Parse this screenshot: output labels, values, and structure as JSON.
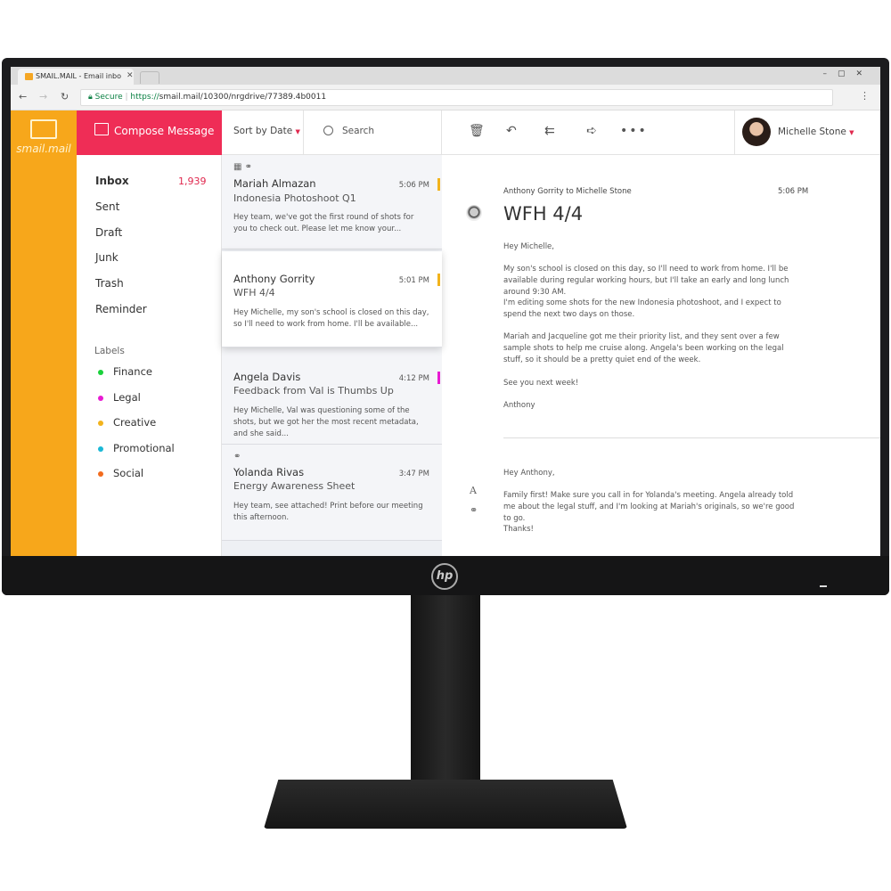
{
  "browser": {
    "tab_title": "SMAIL.MAIL - Email inbo",
    "secure_label": "Secure",
    "url_scheme": "https://",
    "url_rest": "smail.mail/10300/nrgdrive/77389.4b0011"
  },
  "brand": {
    "logo_text": "smail.mail",
    "accent": "#f7a71b",
    "compose_color": "#ef2d56",
    "monitor_logo": "hp"
  },
  "header": {
    "compose_label": "Compose Message",
    "sort_label": "Sort by Date",
    "search_placeholder": "Search",
    "user_name": "Michelle Stone"
  },
  "nav": {
    "items": [
      {
        "label": "Inbox",
        "count": "1,939"
      },
      {
        "label": "Sent"
      },
      {
        "label": "Draft"
      },
      {
        "label": "Junk"
      },
      {
        "label": "Trash"
      },
      {
        "label": "Reminder"
      }
    ],
    "labels_heading": "Labels",
    "labels": [
      {
        "label": "Finance",
        "color": "#19d13a"
      },
      {
        "label": "Legal",
        "color": "#e81ad2"
      },
      {
        "label": "Creative",
        "color": "#f2b31c"
      },
      {
        "label": "Promotional",
        "color": "#1ab8d6"
      },
      {
        "label": "Social",
        "color": "#f26b1d"
      }
    ]
  },
  "messages": [
    {
      "sender": "Mariah Almazan",
      "subject": "Indonesia Photoshoot Q1",
      "time": "5:06 PM",
      "preview": "Hey team, we've got the first round of shots for you to check out. Please let me know your...",
      "tag_color": "#f2b31c",
      "icons": [
        "calendar-icon",
        "link-icon"
      ]
    },
    {
      "sender": "Anthony Gorrity",
      "subject": "WFH 4/4",
      "time": "5:01 PM",
      "preview": "Hey Michelle, my son's school is closed on this day, so I'll need to work from home. I'll be available...",
      "tag_color": "#f2b31c",
      "selected": true
    },
    {
      "sender": "Angela Davis",
      "subject": "Feedback from Val is Thumbs Up",
      "time": "4:12 PM",
      "preview": "Hey Michelle, Val was questioning some of the shots, but we got her the most recent metadata, and she said...",
      "tag_color": "#e81ad2"
    },
    {
      "sender": "Yolanda Rivas",
      "subject": "Energy Awareness Sheet",
      "time": "3:47 PM",
      "preview": "Hey team, see attached! Print before our meeting this afternoon.",
      "icons": [
        "link-icon"
      ]
    }
  ],
  "reading": {
    "from_line": "Anthony Gorrity to Michelle Stone",
    "time": "5:06 PM",
    "subject": "WFH 4/4",
    "body": [
      "Hey Michelle,",
      "My son's school is closed on this day, so I'll need to work from home. I'll be available during regular working hours, but I'll take an early and long lunch around 9:30 AM.",
      "I'm editing some shots for the new Indonesia photoshoot, and I expect to spend the next two days on those.",
      "Mariah and Jacqueline got me their priority list, and they sent over a few sample shots to help me cruise along. Angela's been working on the legal stuff, so it should be a pretty quiet end of the week.",
      "See you next week!",
      "Anthony"
    ],
    "reply": [
      "Hey Anthony,",
      "Family first! Make sure you call in for Yolanda's meeting. Angela already told me about the legal stuff, and I'm looking at Mariah's originals, so we're good to go.",
      "Thanks!"
    ]
  }
}
